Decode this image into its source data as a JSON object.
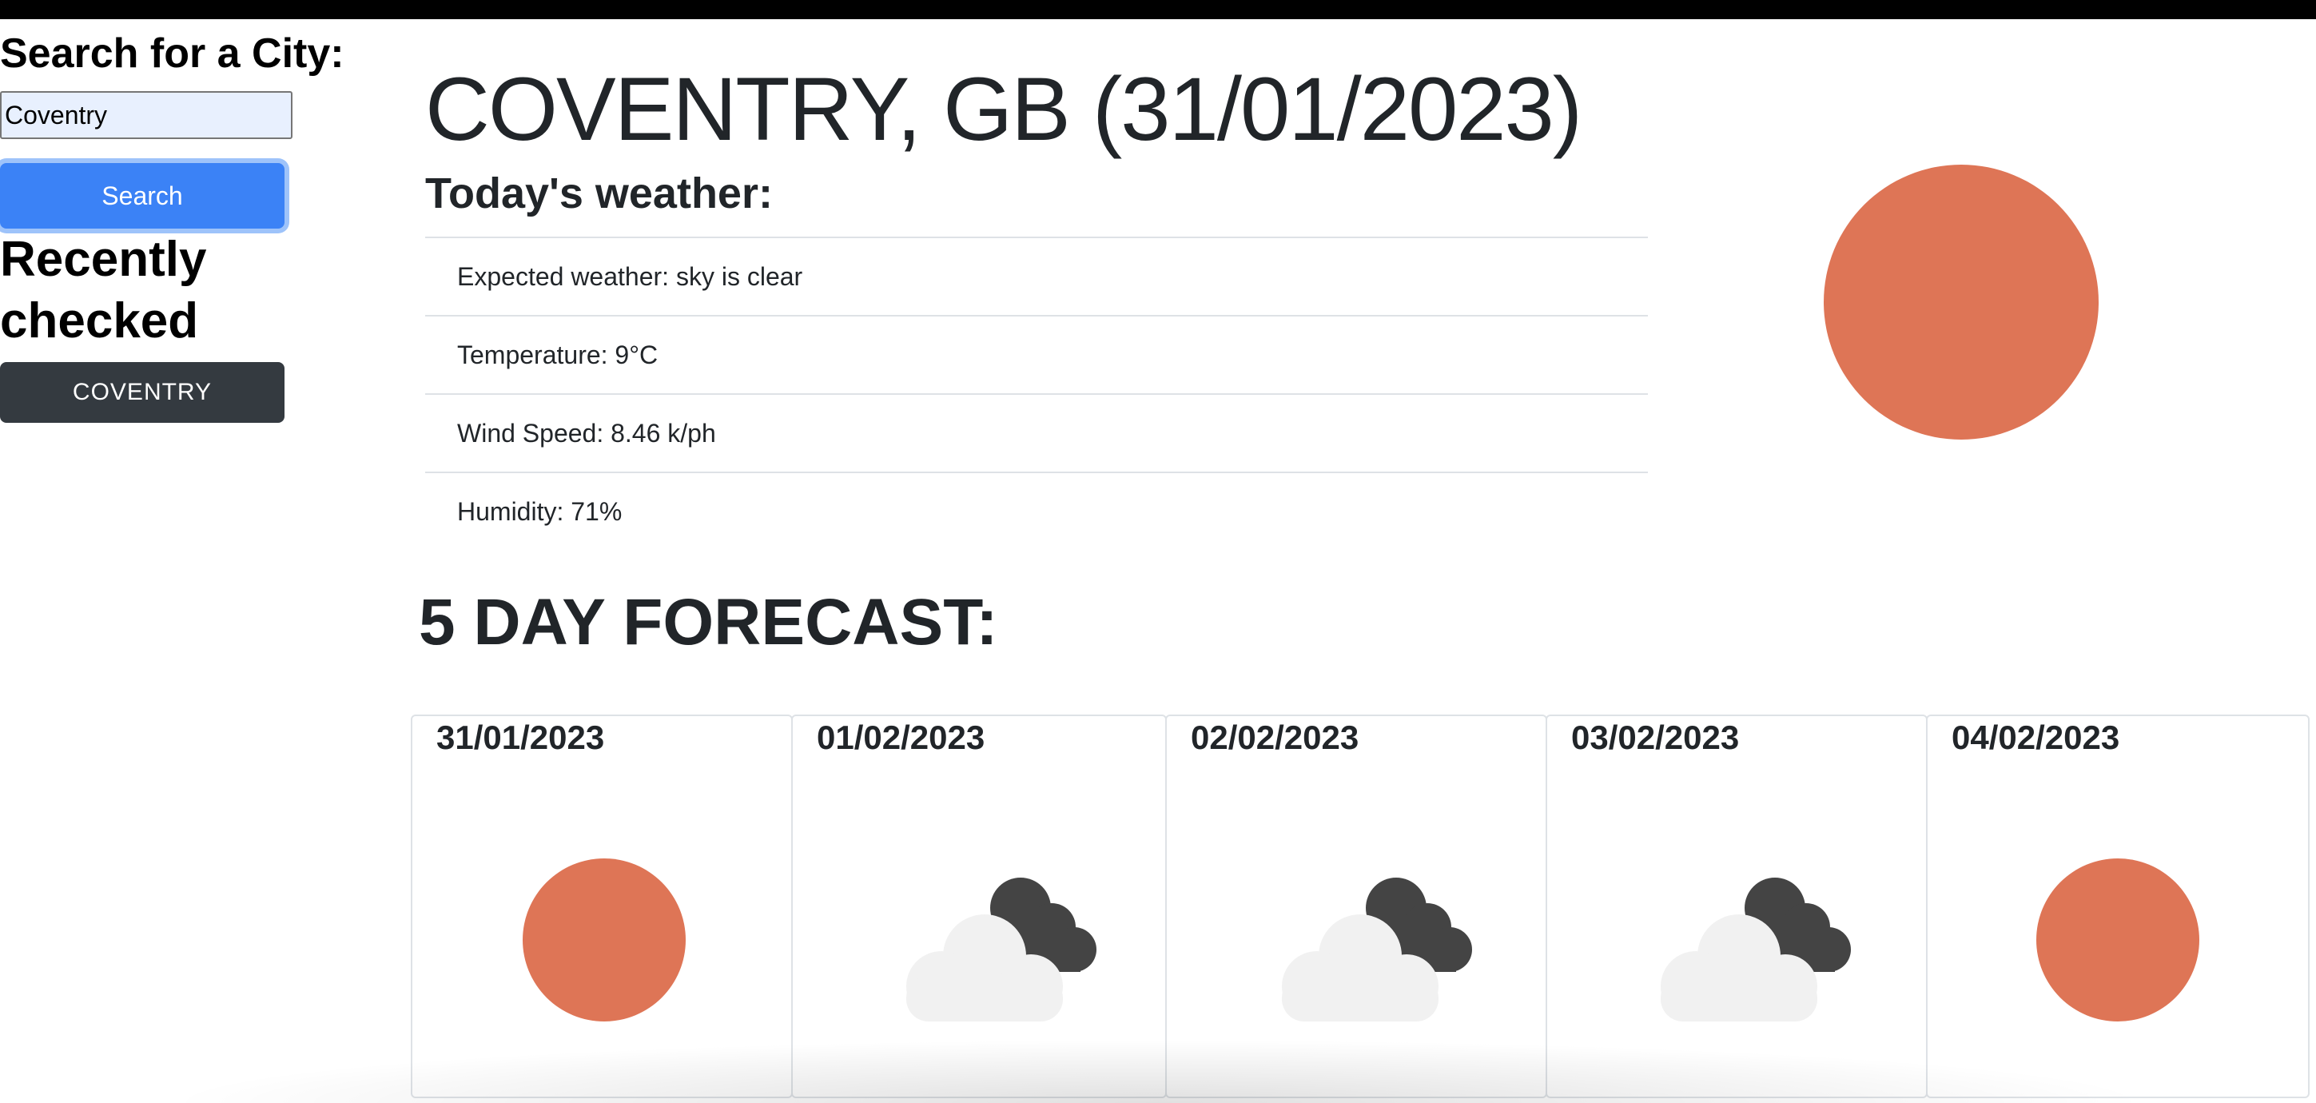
{
  "sidebar": {
    "search_heading": "Search for a City:",
    "search_value": "Coventry",
    "search_button": "Search",
    "recent_heading": "Recently checked cities",
    "recent_cities": [
      "COVENTRY"
    ]
  },
  "current": {
    "title": "COVENTRY, GB (31/01/2023)",
    "today_heading": "Today's weather:",
    "details": [
      "Expected weather: sky is clear",
      "Temperature: 9°C",
      "Wind Speed: 8.46 k/ph",
      "Humidity: 71%"
    ],
    "icon": "sun-icon"
  },
  "forecast": {
    "heading": "5 DAY FORECAST:",
    "days": [
      {
        "date": "31/01/2023",
        "icon": "sun-icon"
      },
      {
        "date": "01/02/2023",
        "icon": "clouds-icon"
      },
      {
        "date": "02/02/2023",
        "icon": "clouds-icon"
      },
      {
        "date": "03/02/2023",
        "icon": "clouds-icon"
      },
      {
        "date": "04/02/2023",
        "icon": "sun-icon"
      }
    ]
  },
  "colors": {
    "sun": "#de7556",
    "cloud_light": "#f1f1f1",
    "cloud_dark": "#444444",
    "search_button": "#3b82f6",
    "recent_button": "#343a40"
  }
}
